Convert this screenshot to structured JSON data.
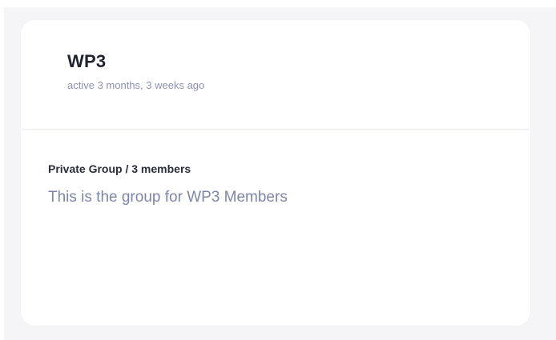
{
  "group_card": {
    "title": "WP3",
    "activity": "active 3 months, 3 weeks ago",
    "meta": "Private Group / 3 members",
    "description": "This is the group for WP3 Members"
  }
}
